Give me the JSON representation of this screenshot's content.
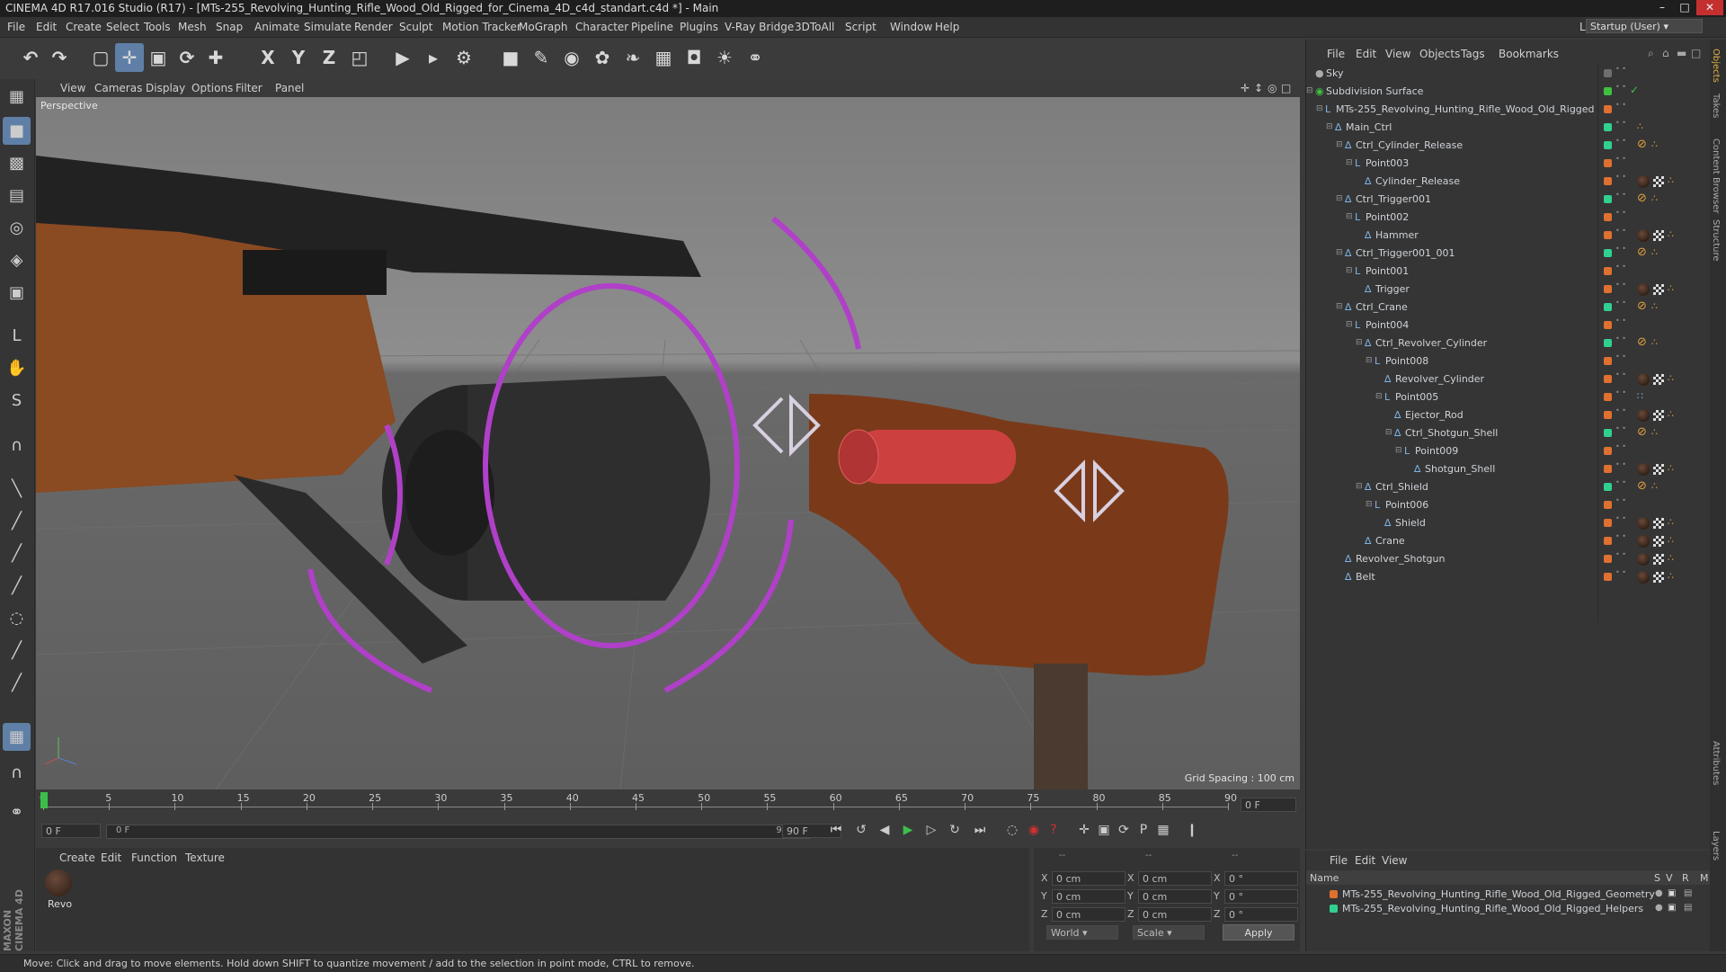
{
  "window": {
    "title": "CINEMA 4D R17.016 Studio (R17) - [MTs-255_Revolving_Hunting_Rifle_Wood_Old_Rigged_for_Cinema_4D_c4d_standart.c4d *] - Main",
    "min": "–",
    "max": "□",
    "close": "✕"
  },
  "menu": [
    "File",
    "Edit",
    "Create",
    "Select",
    "Tools",
    "Mesh",
    "Snap",
    "Animate",
    "Simulate",
    "Render",
    "Sculpt",
    "Motion Tracker",
    "MoGraph",
    "Character",
    "Pipeline",
    "Plugins",
    "V-Ray Bridge",
    "3DToAll",
    "Script",
    "Window",
    "Help"
  ],
  "layout": {
    "label": "Layout:",
    "value": "Startup (User)"
  },
  "viewport": {
    "menu": [
      "View",
      "Cameras",
      "Display",
      "Options",
      "Filter",
      "Panel"
    ],
    "label": "Perspective",
    "grid_spacing": "Grid Spacing : 100 cm"
  },
  "timeline": {
    "ticks": [
      "0",
      "5",
      "10",
      "15",
      "20",
      "25",
      "30",
      "35",
      "40",
      "45",
      "50",
      "55",
      "60",
      "65",
      "70",
      "75",
      "80",
      "85",
      "90"
    ],
    "frame_end_field": "0 F",
    "current": "0 F",
    "range_start": "0 F",
    "range_end": "90 F",
    "max": "90 F"
  },
  "material": {
    "menu": [
      "Create",
      "Edit",
      "Function",
      "Texture"
    ],
    "items": [
      {
        "name": "Revo"
      }
    ]
  },
  "coords": {
    "headers": [
      "--",
      "--",
      "--"
    ],
    "rows": [
      {
        "a": "X",
        "av": "0 cm",
        "b": "X",
        "bv": "0 cm",
        "c": "X",
        "cv": "0 °"
      },
      {
        "a": "Y",
        "av": "0 cm",
        "b": "Y",
        "bv": "0 cm",
        "c": "Y",
        "cv": "0 °"
      },
      {
        "a": "Z",
        "av": "0 cm",
        "b": "Z",
        "bv": "0 cm",
        "c": "Z",
        "cv": "0 °"
      }
    ],
    "world": "World",
    "scale": "Scale",
    "apply": "Apply"
  },
  "status": "Move: Click and drag to move elements. Hold down SHIFT to quantize movement / add to the selection in point mode, CTRL to remove.",
  "objects": {
    "menu": [
      "File",
      "Edit",
      "View",
      "Objects",
      "Tags",
      "Bookmarks"
    ],
    "items": [
      {
        "name": "Sky",
        "depth": 0,
        "color": "#6e6e6e",
        "kind": "sky"
      },
      {
        "name": "Subdivision Surface",
        "depth": 0,
        "color": "#40c040",
        "kind": "subd"
      },
      {
        "name": "MTs-255_Revolving_Hunting_Rifle_Wood_Old_Rigged",
        "depth": 1,
        "color": "#e07030",
        "kind": "null"
      },
      {
        "name": "Main_Ctrl",
        "depth": 2,
        "color": "#30d090",
        "kind": "joint"
      },
      {
        "name": "Ctrl_Cylinder_Release",
        "depth": 3,
        "color": "#30d090",
        "kind": "joint"
      },
      {
        "name": "Point003",
        "depth": 4,
        "color": "#e07030",
        "kind": "null"
      },
      {
        "name": "Cylinder_Release",
        "depth": 5,
        "color": "#e07030",
        "kind": "joint"
      },
      {
        "name": "Ctrl_Trigger001",
        "depth": 3,
        "color": "#30d090",
        "kind": "joint"
      },
      {
        "name": "Point002",
        "depth": 4,
        "color": "#e07030",
        "kind": "null"
      },
      {
        "name": "Hammer",
        "depth": 5,
        "color": "#e07030",
        "kind": "joint"
      },
      {
        "name": "Ctrl_Trigger001_001",
        "depth": 3,
        "color": "#30d090",
        "kind": "joint"
      },
      {
        "name": "Point001",
        "depth": 4,
        "color": "#e07030",
        "kind": "null"
      },
      {
        "name": "Trigger",
        "depth": 5,
        "color": "#e07030",
        "kind": "joint"
      },
      {
        "name": "Ctrl_Crane",
        "depth": 3,
        "color": "#30d090",
        "kind": "joint"
      },
      {
        "name": "Point004",
        "depth": 4,
        "color": "#e07030",
        "kind": "null"
      },
      {
        "name": "Ctrl_Revolver_Cylinder",
        "depth": 5,
        "color": "#30d090",
        "kind": "joint"
      },
      {
        "name": "Point008",
        "depth": 6,
        "color": "#e07030",
        "kind": "null"
      },
      {
        "name": "Revolver_Cylinder",
        "depth": 7,
        "color": "#e07030",
        "kind": "joint"
      },
      {
        "name": "Point005",
        "depth": 7,
        "color": "#e07030",
        "kind": "null"
      },
      {
        "name": "Ejector_Rod",
        "depth": 8,
        "color": "#e07030",
        "kind": "joint"
      },
      {
        "name": "Ctrl_Shotgun_Shell",
        "depth": 8,
        "color": "#30d090",
        "kind": "joint"
      },
      {
        "name": "Point009",
        "depth": 9,
        "color": "#e07030",
        "kind": "null"
      },
      {
        "name": "Shotgun_Shell",
        "depth": 10,
        "color": "#e07030",
        "kind": "joint"
      },
      {
        "name": "Ctrl_Shield",
        "depth": 5,
        "color": "#30d090",
        "kind": "joint"
      },
      {
        "name": "Point006",
        "depth": 6,
        "color": "#e07030",
        "kind": "null"
      },
      {
        "name": "Shield",
        "depth": 7,
        "color": "#e07030",
        "kind": "joint"
      },
      {
        "name": "Crane",
        "depth": 5,
        "color": "#e07030",
        "kind": "joint"
      },
      {
        "name": "Revolver_Shotgun",
        "depth": 3,
        "color": "#e07030",
        "kind": "joint"
      },
      {
        "name": "Belt",
        "depth": 3,
        "color": "#e07030",
        "kind": "joint"
      }
    ]
  },
  "layers": {
    "menu": [
      "File",
      "Edit",
      "View"
    ],
    "columns": {
      "name": "Name",
      "s": "S",
      "v": "V",
      "r": "R",
      "m": "M"
    },
    "items": [
      {
        "name": "MTs-255_Revolving_Hunting_Rifle_Wood_Old_Rigged_Geometry",
        "color": "#e07030"
      },
      {
        "name": "MTs-255_Revolving_Hunting_Rifle_Wood_Old_Rigged_Helpers",
        "color": "#30d090"
      }
    ]
  },
  "side_tabs": [
    "Objects",
    "Takes",
    "Content Browser",
    "Structure",
    "Attributes",
    "Layers"
  ]
}
